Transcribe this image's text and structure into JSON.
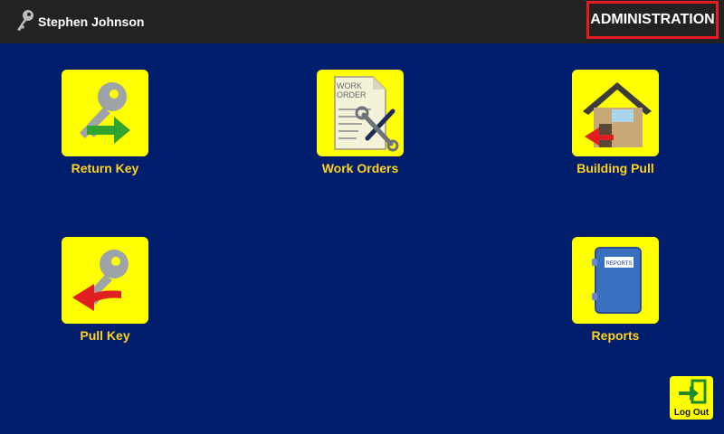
{
  "user": {
    "name": "Stephen Johnson",
    "icon": "key-icon"
  },
  "header": {
    "admin_label": "ADMINISTRATION",
    "highlight_color": "#e41b23"
  },
  "tiles": [
    {
      "label": "Return Key",
      "icon": "return-key-icon"
    },
    {
      "label": "Work Orders",
      "icon": "work-order-icon"
    },
    {
      "label": "Building Pull",
      "icon": "building-pull-icon"
    },
    {
      "label": "Pull Key",
      "icon": "pull-key-icon"
    },
    {
      "label": "Reports",
      "icon": "reports-icon"
    }
  ],
  "work_order_doc_text": [
    "WORK",
    "ORDER"
  ],
  "report_doc_text": "REPORTS",
  "logout": {
    "label": "Log Out",
    "icon": "logout-icon"
  },
  "colors": {
    "background": "#001e6b",
    "topbar": "#222222",
    "tile": "#ffff00",
    "label": "#ffd21f"
  }
}
